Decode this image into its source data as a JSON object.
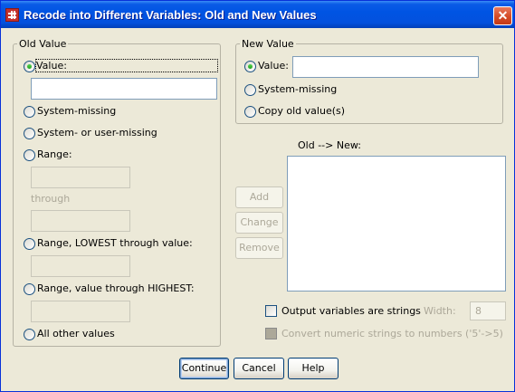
{
  "window": {
    "title": "Recode into Different Variables: Old and New Values",
    "close_glyph": "✕"
  },
  "old_value": {
    "legend": "Old Value",
    "value_label": "Value:",
    "value_input": "",
    "system_missing_label": "System-missing",
    "system_or_user_missing_label": "System- or user-missing",
    "range_label": "Range:",
    "through_label": "through",
    "range_lowest_label": "Range, LOWEST through value:",
    "range_highest_label": "Range, value through HIGHEST:",
    "all_other_label": "All other values",
    "selected": "value"
  },
  "new_value": {
    "legend": "New Value",
    "value_label": "Value:",
    "value_input": "",
    "system_missing_label": "System-missing",
    "copy_old_label": "Copy old value(s)",
    "selected": "value"
  },
  "mapping": {
    "list_label": "Old --> New:",
    "items": [],
    "add_label": "Add",
    "change_label": "Change",
    "remove_label": "Remove"
  },
  "options": {
    "output_strings_label": "Output variables are strings",
    "width_label": "Width:",
    "width_value": "8",
    "convert_numeric_label": "Convert numeric strings to numbers ('5'->5)"
  },
  "footer": {
    "continue_label": "Continue",
    "cancel_label": "Cancel",
    "help_label": "Help"
  }
}
